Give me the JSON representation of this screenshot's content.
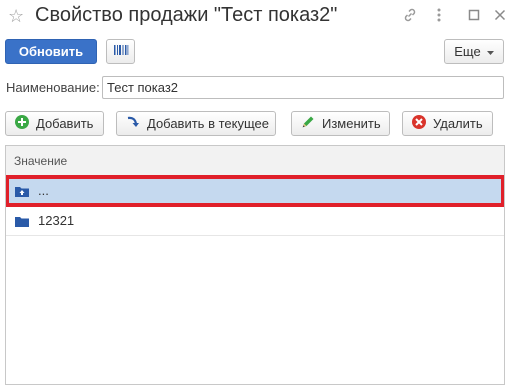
{
  "window": {
    "title": "Свойство продажи \"Тест показ2\""
  },
  "toolbar": {
    "refresh_label": "Обновить",
    "more_label": "Еще"
  },
  "form": {
    "name_label": "Наименование:",
    "name_value": "Тест показ2"
  },
  "actions": {
    "add_label": "Добавить",
    "add_current_label": "Добавить в текущее",
    "edit_label": "Изменить",
    "delete_label": "Удалить"
  },
  "table": {
    "column_header": "Значение",
    "rows": [
      {
        "value": "...",
        "icon": "folder-up-icon",
        "selected": true
      },
      {
        "value": "12321",
        "icon": "folder-icon",
        "selected": false
      }
    ]
  },
  "colors": {
    "primary": "#3a72c8",
    "selected_row": "#c5d9ef",
    "highlight_outline": "#e0202a",
    "folder": "#2a5aa8"
  }
}
